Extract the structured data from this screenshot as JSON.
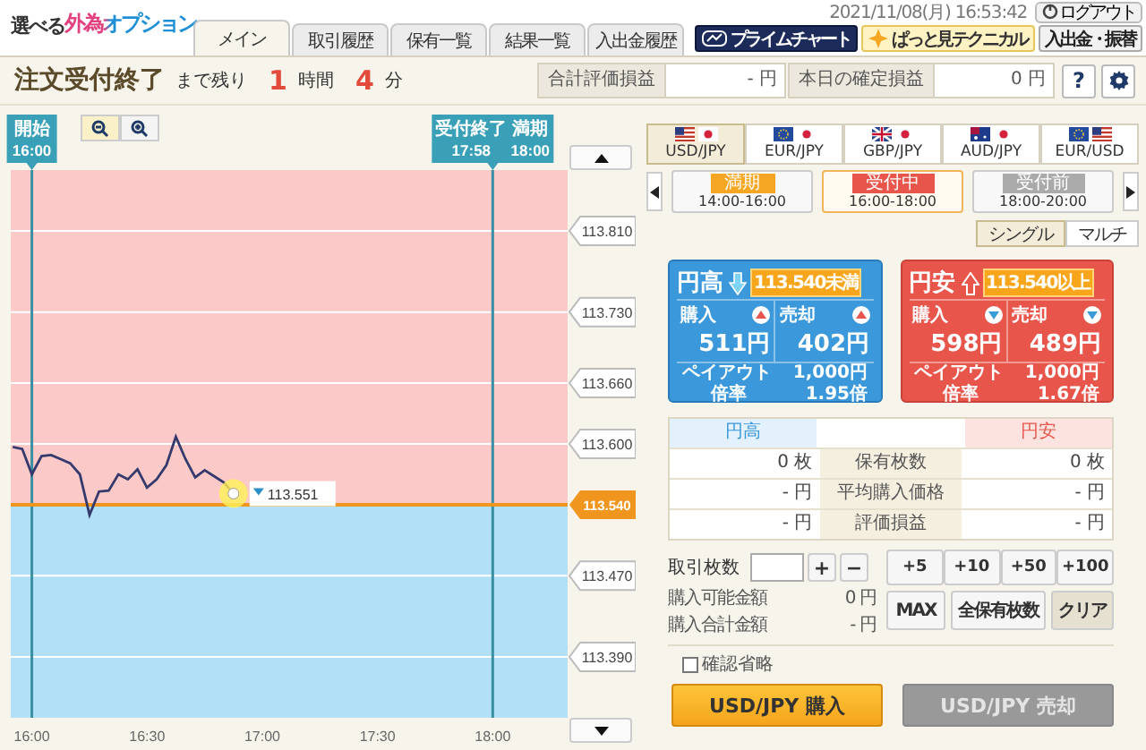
{
  "header": {
    "logo": {
      "prefix": "選べる",
      "main": "外為オプション"
    },
    "tabs": [
      {
        "label": "メイン",
        "selected": true
      },
      {
        "label": "取引履歴",
        "selected": false
      },
      {
        "label": "保有一覧",
        "selected": false
      },
      {
        "label": "結果一覧",
        "selected": false
      },
      {
        "label": "入出金履歴",
        "selected": false
      }
    ],
    "datetime": "2021/11/08(月) 16:53:42",
    "logout": "ログアウト",
    "links": [
      {
        "kind": "prime",
        "label": "プライムチャート"
      },
      {
        "kind": "technical",
        "label": "ぱっと見テクニカル"
      },
      {
        "kind": "plain",
        "label": "入出金・振替"
      }
    ]
  },
  "status": {
    "title": "注文受付終了",
    "remaining_label": "まで残り",
    "hours": "1",
    "hours_unit": "時間",
    "minutes": "4",
    "minutes_unit": "分"
  },
  "totals": [
    {
      "label": "合計評価損益",
      "value": "- 円"
    },
    {
      "label": "本日の確定損益",
      "value": "0 円"
    }
  ],
  "help": "?",
  "chart": {
    "markers": [
      {
        "labels": [
          {
            "title": "開始",
            "time": "16:00"
          }
        ]
      },
      {
        "labels": [
          {
            "title": "受付終了",
            "time": "17:58"
          },
          {
            "title": "満期",
            "time": "18:00"
          }
        ]
      }
    ],
    "current": {
      "label": "113.551"
    },
    "chart_data": {
      "type": "line",
      "categories": [
        null,
        null,
        "16:00",
        null,
        null,
        null,
        null,
        null,
        null,
        null,
        null,
        null,
        null,
        null,
        "16:30",
        null,
        null,
        null,
        null,
        null,
        null,
        null,
        null,
        null,
        null,
        null,
        "17:00",
        null,
        null,
        null,
        null,
        null,
        null,
        null,
        null,
        null,
        null,
        null,
        "17:30",
        null,
        null,
        null,
        null,
        null,
        null,
        null,
        null,
        null,
        null,
        null,
        "18:00",
        null,
        null,
        null,
        null,
        null,
        null,
        null
      ],
      "series": [
        {
          "color": "#343a6b",
          "values": [
            113.597,
            113.595,
            113.57,
            113.588,
            113.589,
            113.585,
            113.581,
            113.57,
            113.53,
            113.553,
            113.554,
            113.57,
            113.565,
            113.575,
            113.557,
            113.565,
            113.579,
            113.607,
            113.585,
            113.567,
            113.574,
            113.568,
            113.562,
            113.551,
            null,
            null,
            null,
            null,
            null,
            null,
            null,
            null,
            null,
            null,
            null,
            null,
            null,
            null,
            null,
            null,
            null,
            null,
            null,
            null,
            null,
            null,
            null,
            null,
            null,
            null,
            null,
            null,
            null,
            null,
            null,
            null,
            null,
            null
          ]
        }
      ],
      "ylim": [
        113.33,
        113.87
      ],
      "grid": true,
      "ref_lines": [
        {
          "axis": "y",
          "value": 113.54,
          "label": "113.540",
          "color": "#f0961e"
        }
      ],
      "yticks": [
        {
          "value": 113.81,
          "label": "113.810"
        },
        {
          "value": 113.73,
          "label": "113.730"
        },
        {
          "value": 113.66,
          "label": "113.660"
        },
        {
          "value": 113.6,
          "label": "113.600"
        },
        {
          "value": 113.47,
          "label": "113.470"
        },
        {
          "value": 113.39,
          "label": "113.390"
        }
      ]
    }
  },
  "pairs": [
    {
      "label": "USD/JPY",
      "selected": true
    },
    {
      "label": "EUR/JPY",
      "selected": false
    },
    {
      "label": "GBP/JPY",
      "selected": false
    },
    {
      "label": "AUD/JPY",
      "selected": false
    },
    {
      "label": "EUR/USD",
      "selected": false
    }
  ],
  "sessions": [
    {
      "status": "満期",
      "kind": "expired",
      "time": "14:00-16:00",
      "selected": false
    },
    {
      "status": "受付中",
      "kind": "open",
      "time": "16:00-18:00",
      "selected": true
    },
    {
      "status": "受付前",
      "kind": "upcoming",
      "time": "18:00-20:00",
      "selected": false
    }
  ],
  "modes": [
    {
      "label": "シングル",
      "selected": true
    },
    {
      "label": "マルチ",
      "selected": false
    }
  ],
  "options": [
    {
      "kind": "high",
      "title": "円高",
      "threshold": "113.540未満",
      "buy_label": "購入",
      "buy": "511円",
      "sell_label": "売却",
      "sell": "402円",
      "payout_label": "ペイアウト",
      "payout": "1,000円",
      "ratio_label": "倍率",
      "ratio": "1.95倍"
    },
    {
      "kind": "low",
      "title": "円安",
      "threshold": "113.540以上",
      "buy_label": "購入",
      "buy": "598円",
      "sell_label": "売却",
      "sell": "489円",
      "payout_label": "ペイアウト",
      "payout": "1,000円",
      "ratio_label": "倍率",
      "ratio": "1.67倍"
    }
  ],
  "positions": {
    "headers": [
      "円高",
      "円安"
    ],
    "rows": [
      {
        "high": "0 枚",
        "label": "保有枚数",
        "low": "0 枚"
      },
      {
        "high": "- 円",
        "label": "平均購入価格",
        "low": "- 円"
      },
      {
        "high": "- 円",
        "label": "評価損益",
        "low": "- 円"
      }
    ]
  },
  "order": {
    "quantity_label": "取引枚数",
    "plus": "+",
    "minus": "−",
    "increments": [
      "+5",
      "+10",
      "+50",
      "+100"
    ],
    "info": [
      {
        "label": "購入可能金額",
        "value": "0 円"
      },
      {
        "label": "購入合計金額",
        "value": "- 円"
      }
    ],
    "actions": [
      "MAX",
      "全保有枚数",
      "クリア"
    ],
    "skip_confirm": {
      "label": "確認省略",
      "checked": false
    },
    "buy": {
      "label": "USD/JPY 購入",
      "disabled": false
    },
    "sell": {
      "label": "USD/JPY 売却",
      "disabled": true
    }
  }
}
